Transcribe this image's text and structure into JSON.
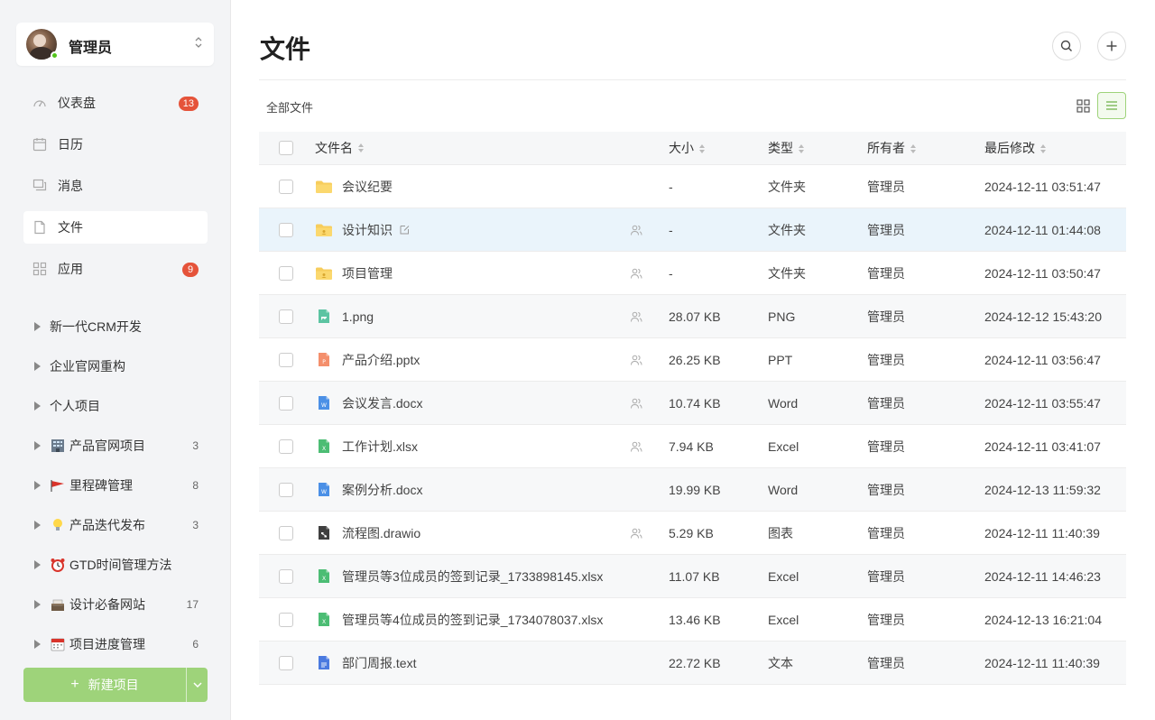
{
  "user": {
    "name": "管理员"
  },
  "nav": [
    {
      "label": "仪表盘",
      "icon": "dashboard-icon",
      "badge": "13",
      "active": false
    },
    {
      "label": "日历",
      "icon": "calendar-icon",
      "badge": "",
      "active": false
    },
    {
      "label": "消息",
      "icon": "message-icon",
      "badge": "",
      "active": false
    },
    {
      "label": "文件",
      "icon": "file-icon",
      "badge": "",
      "active": true
    },
    {
      "label": "应用",
      "icon": "apps-icon",
      "badge": "9",
      "active": false
    }
  ],
  "projects": [
    {
      "label": "新一代CRM开发",
      "emoji": "",
      "count": ""
    },
    {
      "label": "企业官网重构",
      "emoji": "",
      "count": ""
    },
    {
      "label": "个人项目",
      "emoji": "",
      "count": ""
    },
    {
      "label": "产品官网项目",
      "emoji": "building-emoji",
      "count": "3"
    },
    {
      "label": "里程碑管理",
      "emoji": "flag-emoji",
      "count": "8"
    },
    {
      "label": "产品迭代发布",
      "emoji": "bulb-emoji",
      "count": "3"
    },
    {
      "label": "GTD时间管理方法",
      "emoji": "alarm-emoji",
      "count": ""
    },
    {
      "label": "设计必备网站",
      "emoji": "card-box-emoji",
      "count": "17"
    },
    {
      "label": "项目进度管理",
      "emoji": "calendar-emoji",
      "count": "6"
    }
  ],
  "new_project_label": "新建项目",
  "page_title": "文件",
  "breadcrumb": "全部文件",
  "table": {
    "headers": {
      "name": "文件名",
      "size": "大小",
      "type": "类型",
      "owner": "所有者",
      "modified": "最后修改"
    },
    "rows": [
      {
        "name": "会议纪要",
        "icon": "folder",
        "shared": false,
        "size": "-",
        "type": "文件夹",
        "owner": "管理员",
        "modified": "2024-12-11 03:51:47"
      },
      {
        "name": "设计知识",
        "icon": "folder-shared",
        "shared": true,
        "edit": true,
        "size": "-",
        "type": "文件夹",
        "owner": "管理员",
        "modified": "2024-12-11 01:44:08"
      },
      {
        "name": "项目管理",
        "icon": "folder-shared",
        "shared": true,
        "size": "-",
        "type": "文件夹",
        "owner": "管理员",
        "modified": "2024-12-11 03:50:47"
      },
      {
        "name": "1.png",
        "icon": "image",
        "shared": true,
        "size": "28.07 KB",
        "type": "PNG",
        "owner": "管理员",
        "modified": "2024-12-12 15:43:20"
      },
      {
        "name": "产品介绍.pptx",
        "icon": "ppt",
        "shared": true,
        "size": "26.25 KB",
        "type": "PPT",
        "owner": "管理员",
        "modified": "2024-12-11 03:56:47"
      },
      {
        "name": "会议发言.docx",
        "icon": "word",
        "shared": true,
        "size": "10.74 KB",
        "type": "Word",
        "owner": "管理员",
        "modified": "2024-12-11 03:55:47"
      },
      {
        "name": "工作计划.xlsx",
        "icon": "excel",
        "shared": true,
        "size": "7.94 KB",
        "type": "Excel",
        "owner": "管理员",
        "modified": "2024-12-11 03:41:07"
      },
      {
        "name": "案例分析.docx",
        "icon": "word",
        "shared": false,
        "size": "19.99 KB",
        "type": "Word",
        "owner": "管理员",
        "modified": "2024-12-13 11:59:32"
      },
      {
        "name": "流程图.drawio",
        "icon": "drawio",
        "shared": true,
        "size": "5.29 KB",
        "type": "图表",
        "owner": "管理员",
        "modified": "2024-12-11 11:40:39"
      },
      {
        "name": "管理员等3位成员的签到记录_1733898145.xlsx",
        "icon": "excel",
        "shared": false,
        "size": "11.07 KB",
        "type": "Excel",
        "owner": "管理员",
        "modified": "2024-12-11 14:46:23"
      },
      {
        "name": "管理员等4位成员的签到记录_1734078037.xlsx",
        "icon": "excel",
        "shared": false,
        "size": "13.46 KB",
        "type": "Excel",
        "owner": "管理员",
        "modified": "2024-12-13 16:21:04"
      },
      {
        "name": "部门周报.text",
        "icon": "text",
        "shared": false,
        "size": "22.72 KB",
        "type": "文本",
        "owner": "管理员",
        "modified": "2024-12-11 11:40:39"
      }
    ]
  },
  "colors": {
    "accent": "#9ed37a",
    "badge": "#e5533a",
    "highlight_row": "#eaf4fb",
    "online": "#52c41a"
  }
}
